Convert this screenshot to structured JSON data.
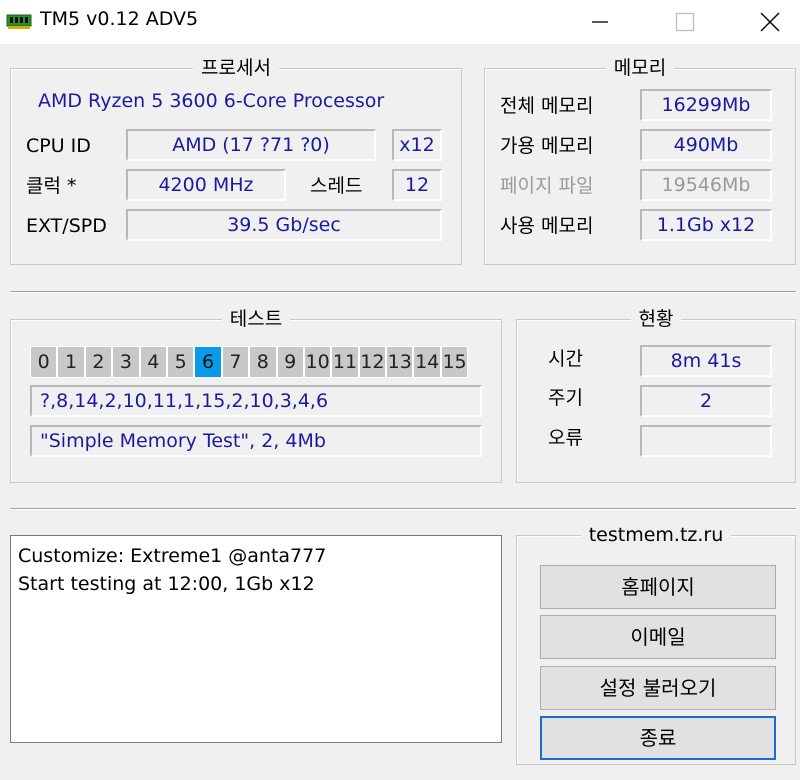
{
  "window": {
    "title": "TM5 v0.12 ADV5"
  },
  "icons": {
    "app": "memory-chip-icon",
    "minimize": "minimize-icon",
    "maximize": "maximize-icon",
    "close": "close-icon"
  },
  "processor": {
    "title": "프로세서",
    "name": "AMD Ryzen 5 3600 6-Core Processor",
    "cpu_id_label": "CPU ID",
    "cpu_id_value": "AMD  (17 ?71 ?0)",
    "core_count": "x12",
    "clock_label": "클럭 *",
    "clock_value": "4200 MHz",
    "threads_label": "스레드",
    "threads_value": "12",
    "ext_label": "EXT/SPD",
    "ext_value": "39.5 Gb/sec"
  },
  "memory": {
    "title": "메모리",
    "total_label": "전체 메모리",
    "total_value": "16299Mb",
    "available_label": "가용 메모리",
    "available_value": "490Mb",
    "pagefile_label": "페이지 파일",
    "pagefile_value": "19546Mb",
    "used_label": "사용 메모리",
    "used_value": "1.1Gb x12"
  },
  "test": {
    "title": "테스트",
    "numbers": [
      "0",
      "1",
      "2",
      "3",
      "4",
      "5",
      "6",
      "7",
      "8",
      "9",
      "10",
      "11",
      "12",
      "13",
      "14",
      "15"
    ],
    "active_index": 6,
    "sequence": "?,8,14,2,10,11,1,15,2,10,3,4,6",
    "current": "\"Simple Memory Test\", 2, 4Mb"
  },
  "status": {
    "title": "현황",
    "time_label": "시간",
    "time_value": "8m 41s",
    "cycle_label": "주기",
    "cycle_value": "2",
    "error_label": "오류",
    "error_value": ""
  },
  "log": {
    "lines": [
      "Customize: Extreme1 @anta777",
      "Start testing at 12:00, 1Gb x12"
    ]
  },
  "links": {
    "title": "testmem.tz.ru",
    "homepage": "홈페이지",
    "email": "이메일",
    "load_settings": "설정 불러오기",
    "exit": "종료"
  },
  "colors": {
    "accent": "#0a9be8",
    "value_text": "#1a1aa0",
    "default_button_border": "#1c6dd0"
  }
}
